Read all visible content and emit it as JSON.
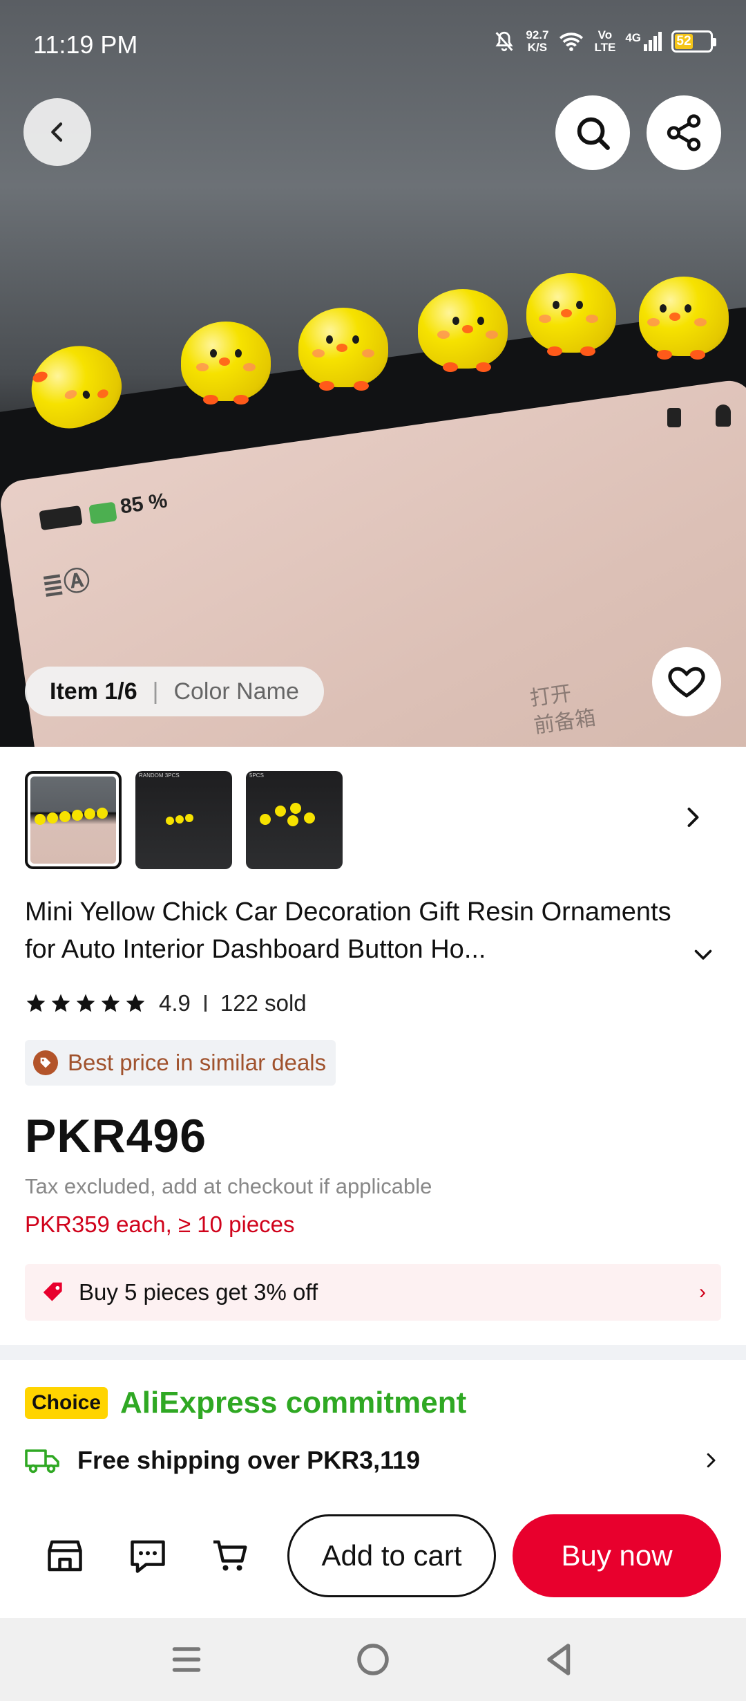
{
  "status": {
    "time": "11:19 PM",
    "net_speed_top": "92.7",
    "net_speed_unit": "K/S",
    "volte_top": "Vo",
    "volte_bottom": "LTE",
    "network": "4G",
    "battery": "52"
  },
  "hero": {
    "item_label": "Item 1/6",
    "variant_label": "Color Name",
    "screen_battery_text": "85 %",
    "screen_cn_line1": "打开",
    "screen_cn_line2": "前备箱"
  },
  "thumbnails": [
    {
      "label": ""
    },
    {
      "label": "RANDOM 3PCS"
    },
    {
      "label": "5PCS"
    }
  ],
  "product": {
    "title": "Mini Yellow Chick Car Decoration Gift Resin Ornaments for Auto Interior Dashboard Button Ho...",
    "rating": "4.9",
    "sold": "122 sold",
    "best_price_label": "Best price in similar deals",
    "price": "PKR496",
    "tax_note": "Tax excluded, add at checkout if applicable",
    "bulk_price": "PKR359 each, ≥ 10 pieces",
    "promo_text": "Buy 5 pieces get 3% off"
  },
  "commitment": {
    "badge": "Choice",
    "title": "AliExpress commitment",
    "shipping": "Free shipping over PKR3,119"
  },
  "actions": {
    "add_to_cart": "Add to cart",
    "buy_now": "Buy now"
  },
  "colors": {
    "accent_red": "#e8002d",
    "choice_yellow": "#ffd400",
    "commit_green": "#2fa823",
    "star_color": "#111111"
  },
  "icons": [
    "back-icon",
    "search-icon",
    "share-icon",
    "heart-icon",
    "chevron-right-icon",
    "chevron-down-icon",
    "star-icon",
    "price-tag-icon",
    "truck-icon",
    "store-icon",
    "chat-icon",
    "cart-icon",
    "menu-icon",
    "home-icon",
    "back-triangle-icon"
  ]
}
